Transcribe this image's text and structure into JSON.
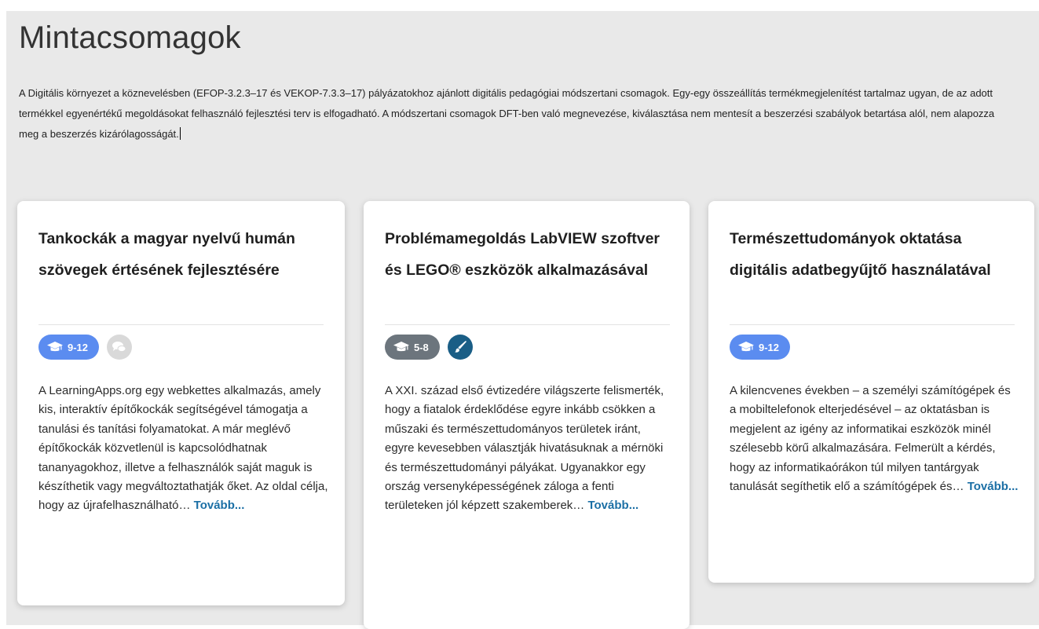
{
  "page": {
    "title": "Mintacsomagok",
    "intro": "A Digitális környezet a köznevelésben (EFOP-3.2.3–17 és VEKOP-7.3.3–17) pályázatokhoz ajánlott digitális pedagógiai módszertani csomagok. Egy-egy összeállítás termékmegjelenítést tartalmaz ugyan, de az adott termékkel egyenértékű megoldásokat felhasználó fejlesztési terv is elfogadható. A módszertani csomagok DFT-ben való megnevezése, kiválasztása nem mentesít a beszerzési szabályok betartása alól, nem alapozza meg a beszerzés kizárólagosságát.",
    "background_color": "#e9e9e9"
  },
  "cards": [
    {
      "title": "Tankockák a magyar nyelvű humán szövegek értésének fejlesztésére",
      "grade": "9-12",
      "grade_icon": "graduation-cap-icon",
      "grade_color": "#5b8cf0",
      "secondary_icon": "chat-bubbles-icon",
      "secondary_color": "#d9d9d9",
      "text": "A LearningApps.org egy webkettes alkalmazás, amely kis, interaktív építőkockák segítségével támogatja a tanulási és tanítási folyamatokat. A már meglévő építőkockák közvetlenül is kapcsolódhatnak tananyagokhoz, illetve a felhasználók saját maguk is készíthetik vagy megváltoztathatják őket. Az oldal célja, hogy az újrafelhasználható…",
      "more": "Tovább..."
    },
    {
      "title": "Problémamegoldás LabVIEW szoftver és LEGO® eszközök alkalmazásával",
      "grade": "5-8",
      "grade_icon": "graduation-cap-icon",
      "grade_color": "#6c757d",
      "secondary_icon": "paintbrush-icon",
      "secondary_color": "#1a5e86",
      "text": "A XXI. század első évtizedére világszerte felismerték, hogy a fiatalok érdeklődése egyre inkább csökken a műszaki és természettudományos területek iránt, egyre kevesebben választják hivatásuknak a mérnöki és természettudományi pályákat. Ugyanakkor egy ország versenyképességének záloga a fenti területeken jól képzett szakemberek…",
      "more": "Tovább..."
    },
    {
      "title": "Természettudományok oktatása digitális adatbegyűjtő használatával",
      "grade": "9-12",
      "grade_icon": "graduation-cap-icon",
      "grade_color": "#5b8cf0",
      "text": "A kilencvenes években – a személyi számítógépek és a mobiltelefonok elterjedésével – az oktatásban is megjelent az igény az informatikai eszközök minél szélesebb körű alkalmazására. Felmerült a kérdés, hogy az informatikaórákon túl milyen tantárgyak tanulását segíthetik elő a számítógépek és…",
      "more": "Tovább..."
    }
  ]
}
